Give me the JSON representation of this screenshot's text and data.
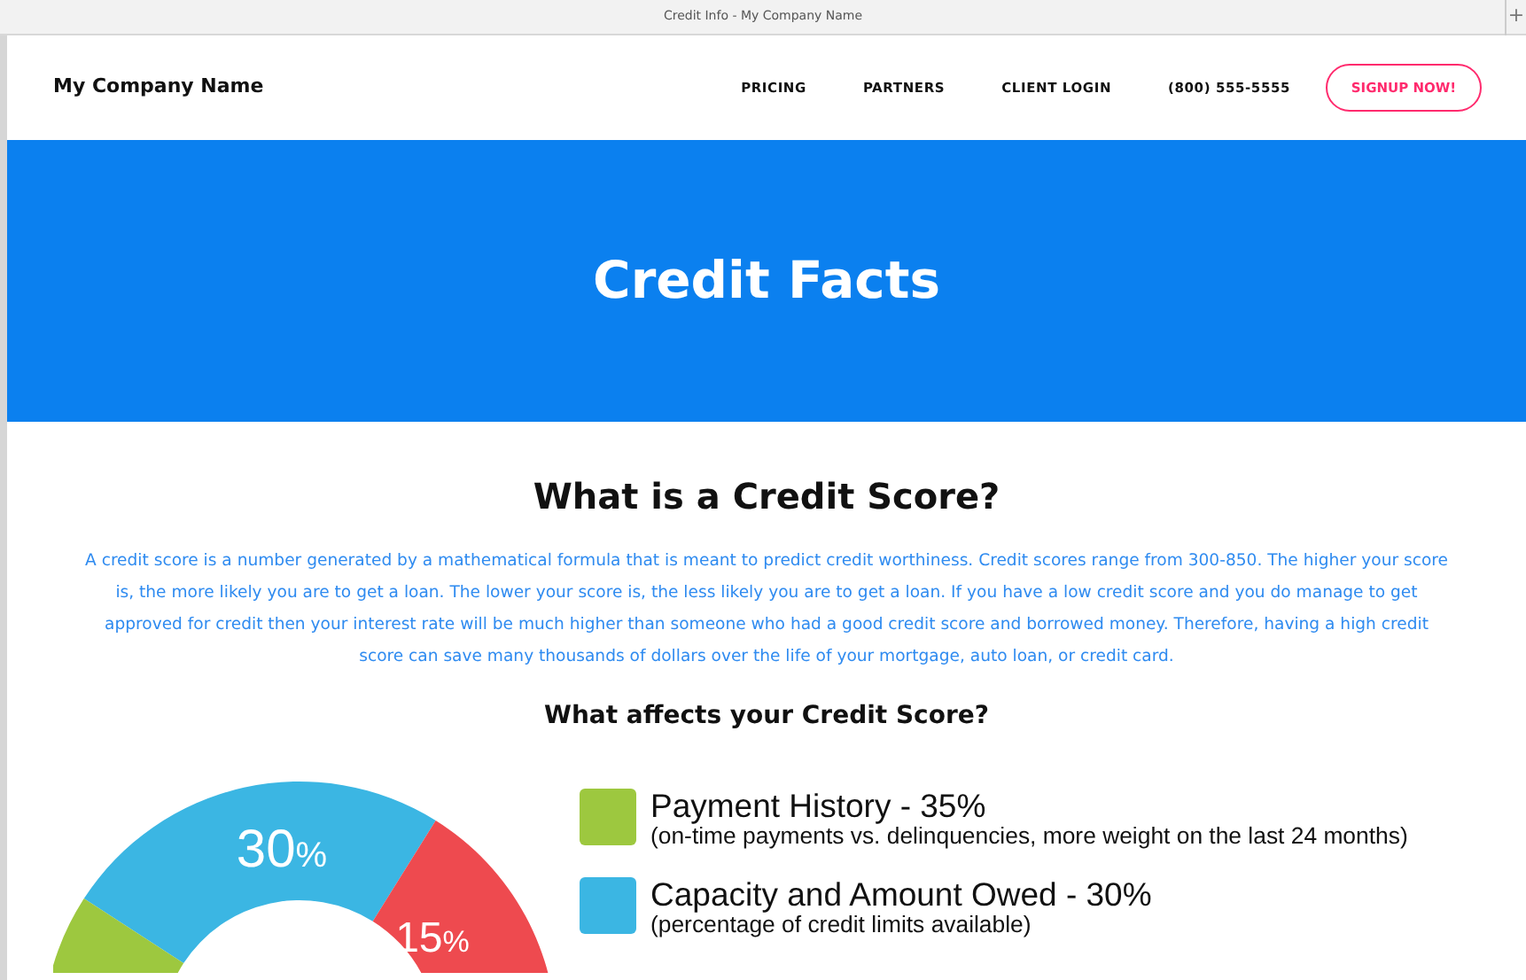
{
  "window": {
    "title": "Credit Info - My Company Name",
    "new_tab": "+"
  },
  "navbar": {
    "brand": "My Company Name",
    "links": [
      "PRICING",
      "PARTNERS",
      "CLIENT LOGIN",
      "(800) 555-5555"
    ],
    "signup": "SIGNUP NOW!"
  },
  "hero": {
    "title": "Credit Facts"
  },
  "section": {
    "heading": "What is a Credit Score?",
    "paragraph": "A credit score is a number generated by a mathematical formula that is meant to predict credit worthiness. Credit scores range from 300-850. The higher your score is, the more likely you are to get a loan. The lower your score is, the less likely you are to get a loan. If you have a low credit score and you do manage to get approved for credit then your interest rate will be much higher than someone who had a good credit score and borrowed money. Therefore, having a high credit score can save many thousands of dollars over the life of your mortgage, auto loan, or credit card.",
    "subheading": "What affects your Credit Score?"
  },
  "breakdown": {
    "segments": [
      {
        "value": "30",
        "unit": "%",
        "color": "#3bb6e3"
      },
      {
        "value": "15",
        "unit": "%",
        "color": "#ee4a4f"
      },
      {
        "color": "#9dc83f"
      }
    ],
    "legend": [
      {
        "title": "Payment History - 35%",
        "note": "(on-time payments vs. delinquencies, more weight on the last 24 months)",
        "color": "#9dc83f"
      },
      {
        "title": "Capacity and Amount Owed - 30%",
        "note": "(percentage of credit limits available)",
        "color": "#3bb6e3"
      }
    ]
  }
}
